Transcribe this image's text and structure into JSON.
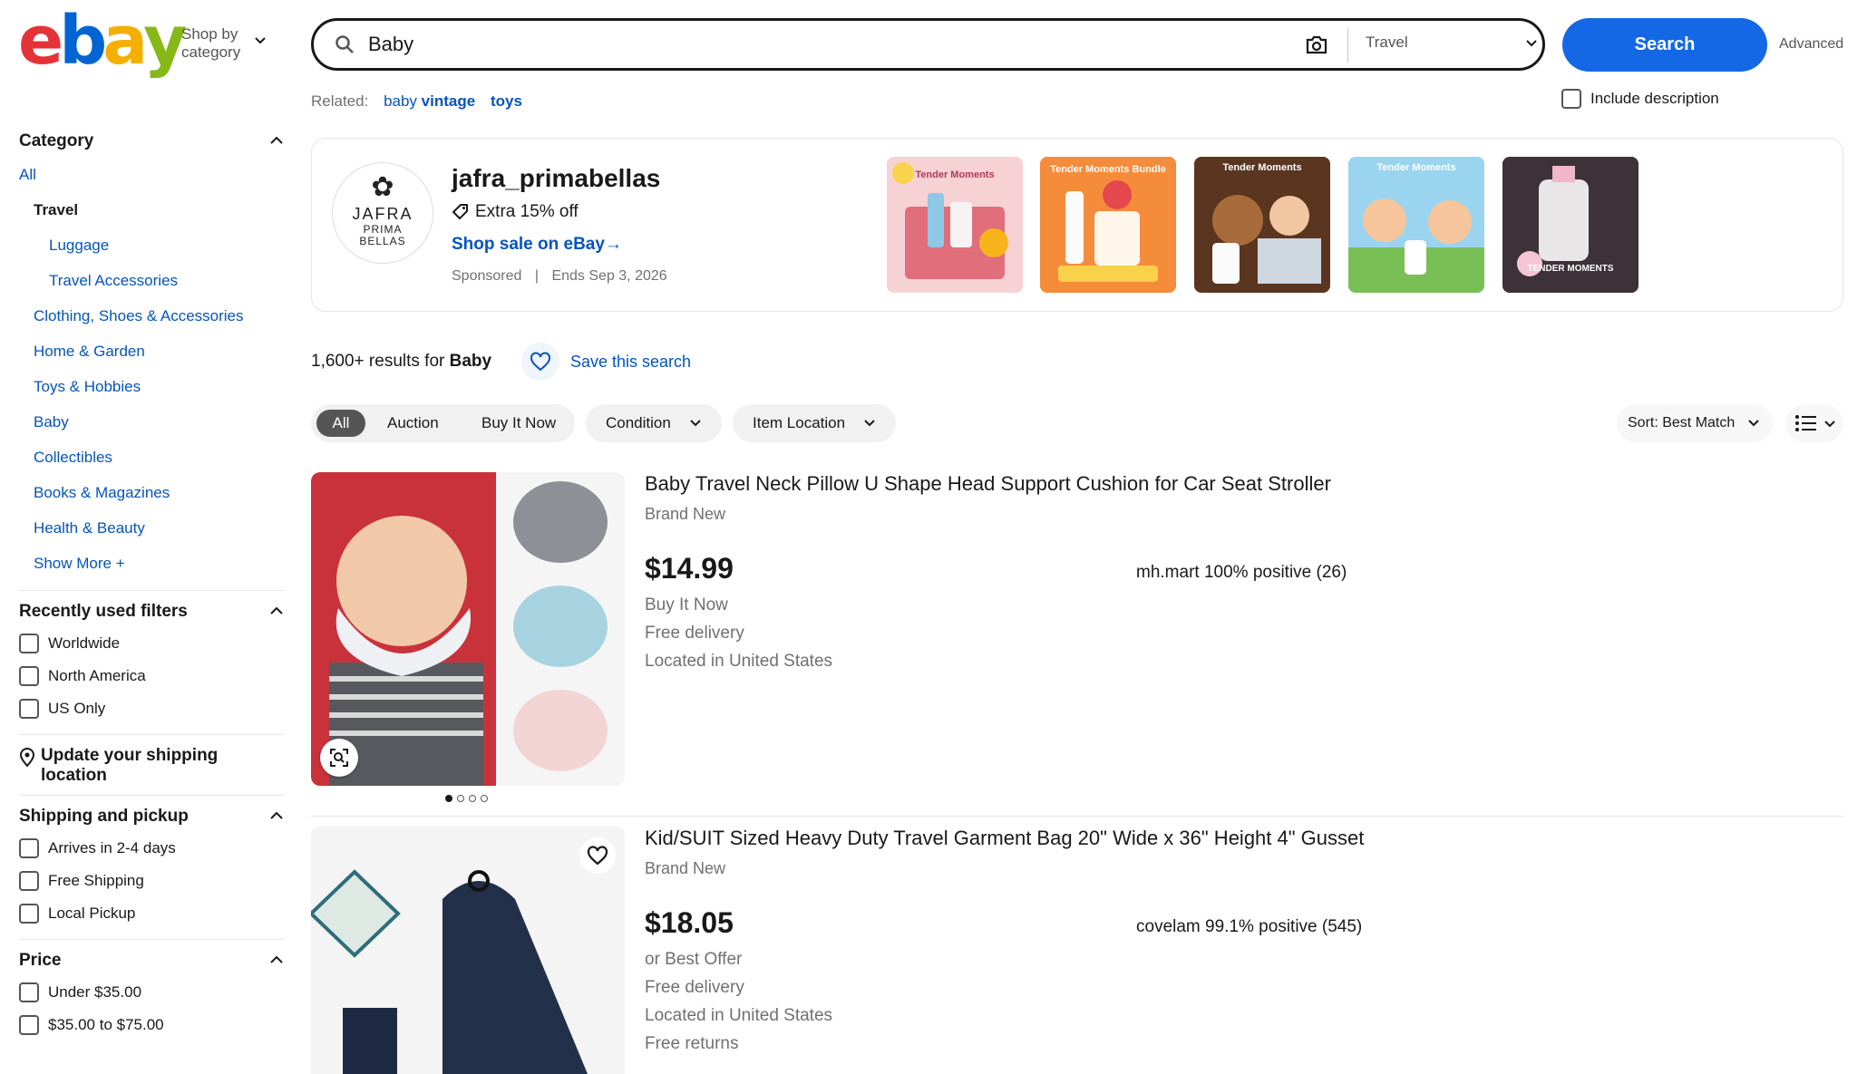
{
  "header": {
    "logo_letters": [
      "e",
      "b",
      "a",
      "y"
    ],
    "logo_colors": [
      "#e53238",
      "#0064d2",
      "#f5af02",
      "#86b817"
    ],
    "shop_by_line1": "Shop by",
    "shop_by_line2": "category",
    "search_value": "Baby",
    "category_select": "Travel",
    "search_button": "Search",
    "advanced": "Advanced",
    "related_label": "Related:",
    "related_1_plain": "baby",
    "related_1_bold": "vintage",
    "related_2": "toys",
    "include_description": "Include description"
  },
  "sidebar": {
    "category_heading": "Category",
    "all": "All",
    "travel": "Travel",
    "travel_subs": [
      "Luggage",
      "Travel Accessories"
    ],
    "categories": [
      "Clothing, Shoes & Accessories",
      "Home & Garden",
      "Toys & Hobbies",
      "Baby",
      "Collectibles",
      "Books & Magazines",
      "Health & Beauty"
    ],
    "show_more": "Show More",
    "show_more_plus": "+",
    "recent_heading": "Recently used filters",
    "recent": [
      "Worldwide",
      "North America",
      "US Only"
    ],
    "update_shipping": "Update your shipping location",
    "shipping_heading": "Shipping and pickup",
    "shipping": [
      "Arrives in 2-4 days",
      "Free Shipping",
      "Local Pickup"
    ],
    "price_heading": "Price",
    "price": [
      "Under $35.00",
      "$35.00 to $75.00"
    ]
  },
  "promo": {
    "logo_line1": "JAFRA",
    "logo_line2": "PRIMA",
    "logo_line3": "BELLAS",
    "seller": "jafra_primabellas",
    "offer": "Extra 15% off",
    "link": "Shop sale on eBay",
    "link_arrow": "→",
    "sponsored": "Sponsored",
    "sep": "|",
    "ends": "Ends Sep 3, 2026",
    "thumbs": [
      {
        "text": "Tender Moments",
        "bg": "#f4c6c9"
      },
      {
        "text": "Tender Moments Bundle",
        "bg": "#f38a3a"
      },
      {
        "text": "Tender Moments",
        "bg": "#7a4a2a"
      },
      {
        "text": "Tender Moments",
        "bg": "#8cc9e6"
      },
      {
        "text": "TENDER MOMENTS",
        "bg": "#3b3036"
      }
    ]
  },
  "results": {
    "count_prefix": "1,600+ results for",
    "query": "Baby",
    "save_search": "Save this search"
  },
  "filters": {
    "all": "All",
    "auction": "Auction",
    "buy_it_now": "Buy It Now",
    "condition": "Condition",
    "item_location": "Item Location",
    "sort": "Sort: Best Match"
  },
  "items": [
    {
      "title": "Baby Travel Neck Pillow U Shape Head Support Cushion for Car Seat Stroller",
      "condition": "Brand New",
      "price": "$14.99",
      "lines": [
        "Buy It Now",
        "Free delivery",
        "Located in United States"
      ],
      "seller": "mh.mart 100% positive (26)"
    },
    {
      "title": "Kid/SUIT Sized Heavy Duty Travel Garment Bag 20\" Wide x 36\" Height 4\" Gusset",
      "condition": "Brand New",
      "price": "$18.05",
      "lines": [
        "or Best Offer",
        "Free delivery",
        "Located in United States",
        "Free returns"
      ],
      "seller": "covelam 99.1% positive (545)"
    }
  ]
}
